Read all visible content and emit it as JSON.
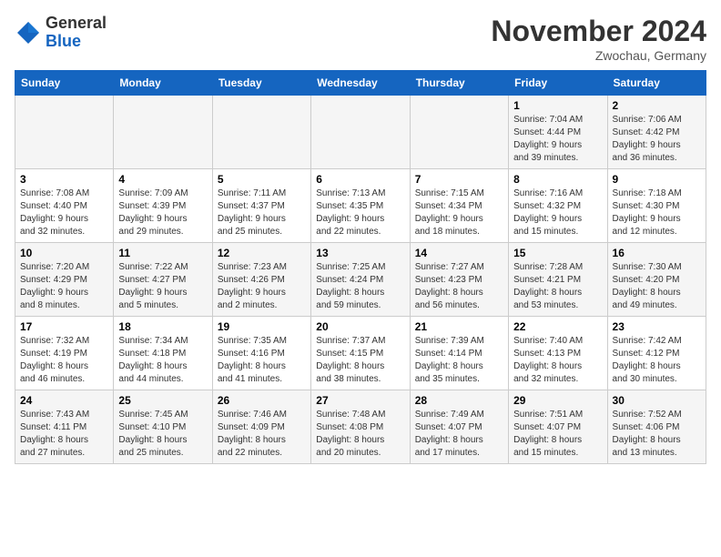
{
  "header": {
    "logo_general": "General",
    "logo_blue": "Blue",
    "month_title": "November 2024",
    "location": "Zwochau, Germany"
  },
  "weekdays": [
    "Sunday",
    "Monday",
    "Tuesday",
    "Wednesday",
    "Thursday",
    "Friday",
    "Saturday"
  ],
  "weeks": [
    [
      {
        "day": "",
        "info": ""
      },
      {
        "day": "",
        "info": ""
      },
      {
        "day": "",
        "info": ""
      },
      {
        "day": "",
        "info": ""
      },
      {
        "day": "",
        "info": ""
      },
      {
        "day": "1",
        "info": "Sunrise: 7:04 AM\nSunset: 4:44 PM\nDaylight: 9 hours\nand 39 minutes."
      },
      {
        "day": "2",
        "info": "Sunrise: 7:06 AM\nSunset: 4:42 PM\nDaylight: 9 hours\nand 36 minutes."
      }
    ],
    [
      {
        "day": "3",
        "info": "Sunrise: 7:08 AM\nSunset: 4:40 PM\nDaylight: 9 hours\nand 32 minutes."
      },
      {
        "day": "4",
        "info": "Sunrise: 7:09 AM\nSunset: 4:39 PM\nDaylight: 9 hours\nand 29 minutes."
      },
      {
        "day": "5",
        "info": "Sunrise: 7:11 AM\nSunset: 4:37 PM\nDaylight: 9 hours\nand 25 minutes."
      },
      {
        "day": "6",
        "info": "Sunrise: 7:13 AM\nSunset: 4:35 PM\nDaylight: 9 hours\nand 22 minutes."
      },
      {
        "day": "7",
        "info": "Sunrise: 7:15 AM\nSunset: 4:34 PM\nDaylight: 9 hours\nand 18 minutes."
      },
      {
        "day": "8",
        "info": "Sunrise: 7:16 AM\nSunset: 4:32 PM\nDaylight: 9 hours\nand 15 minutes."
      },
      {
        "day": "9",
        "info": "Sunrise: 7:18 AM\nSunset: 4:30 PM\nDaylight: 9 hours\nand 12 minutes."
      }
    ],
    [
      {
        "day": "10",
        "info": "Sunrise: 7:20 AM\nSunset: 4:29 PM\nDaylight: 9 hours\nand 8 minutes."
      },
      {
        "day": "11",
        "info": "Sunrise: 7:22 AM\nSunset: 4:27 PM\nDaylight: 9 hours\nand 5 minutes."
      },
      {
        "day": "12",
        "info": "Sunrise: 7:23 AM\nSunset: 4:26 PM\nDaylight: 9 hours\nand 2 minutes."
      },
      {
        "day": "13",
        "info": "Sunrise: 7:25 AM\nSunset: 4:24 PM\nDaylight: 8 hours\nand 59 minutes."
      },
      {
        "day": "14",
        "info": "Sunrise: 7:27 AM\nSunset: 4:23 PM\nDaylight: 8 hours\nand 56 minutes."
      },
      {
        "day": "15",
        "info": "Sunrise: 7:28 AM\nSunset: 4:21 PM\nDaylight: 8 hours\nand 53 minutes."
      },
      {
        "day": "16",
        "info": "Sunrise: 7:30 AM\nSunset: 4:20 PM\nDaylight: 8 hours\nand 49 minutes."
      }
    ],
    [
      {
        "day": "17",
        "info": "Sunrise: 7:32 AM\nSunset: 4:19 PM\nDaylight: 8 hours\nand 46 minutes."
      },
      {
        "day": "18",
        "info": "Sunrise: 7:34 AM\nSunset: 4:18 PM\nDaylight: 8 hours\nand 44 minutes."
      },
      {
        "day": "19",
        "info": "Sunrise: 7:35 AM\nSunset: 4:16 PM\nDaylight: 8 hours\nand 41 minutes."
      },
      {
        "day": "20",
        "info": "Sunrise: 7:37 AM\nSunset: 4:15 PM\nDaylight: 8 hours\nand 38 minutes."
      },
      {
        "day": "21",
        "info": "Sunrise: 7:39 AM\nSunset: 4:14 PM\nDaylight: 8 hours\nand 35 minutes."
      },
      {
        "day": "22",
        "info": "Sunrise: 7:40 AM\nSunset: 4:13 PM\nDaylight: 8 hours\nand 32 minutes."
      },
      {
        "day": "23",
        "info": "Sunrise: 7:42 AM\nSunset: 4:12 PM\nDaylight: 8 hours\nand 30 minutes."
      }
    ],
    [
      {
        "day": "24",
        "info": "Sunrise: 7:43 AM\nSunset: 4:11 PM\nDaylight: 8 hours\nand 27 minutes."
      },
      {
        "day": "25",
        "info": "Sunrise: 7:45 AM\nSunset: 4:10 PM\nDaylight: 8 hours\nand 25 minutes."
      },
      {
        "day": "26",
        "info": "Sunrise: 7:46 AM\nSunset: 4:09 PM\nDaylight: 8 hours\nand 22 minutes."
      },
      {
        "day": "27",
        "info": "Sunrise: 7:48 AM\nSunset: 4:08 PM\nDaylight: 8 hours\nand 20 minutes."
      },
      {
        "day": "28",
        "info": "Sunrise: 7:49 AM\nSunset: 4:07 PM\nDaylight: 8 hours\nand 17 minutes."
      },
      {
        "day": "29",
        "info": "Sunrise: 7:51 AM\nSunset: 4:07 PM\nDaylight: 8 hours\nand 15 minutes."
      },
      {
        "day": "30",
        "info": "Sunrise: 7:52 AM\nSunset: 4:06 PM\nDaylight: 8 hours\nand 13 minutes."
      }
    ]
  ]
}
